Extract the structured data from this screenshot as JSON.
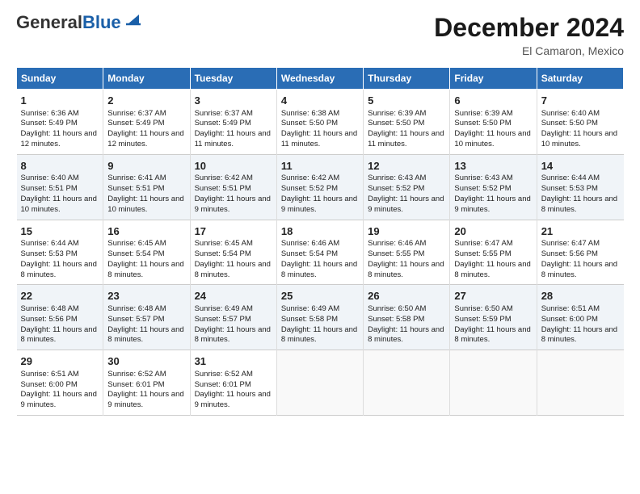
{
  "header": {
    "logo_general": "General",
    "logo_blue": "Blue",
    "month_title": "December 2024",
    "location": "El Camaron, Mexico"
  },
  "days_of_week": [
    "Sunday",
    "Monday",
    "Tuesday",
    "Wednesday",
    "Thursday",
    "Friday",
    "Saturday"
  ],
  "weeks": [
    [
      {
        "day": 1,
        "sunrise": "Sunrise: 6:36 AM",
        "sunset": "Sunset: 5:49 PM",
        "daylight": "Daylight: 11 hours and 12 minutes."
      },
      {
        "day": 2,
        "sunrise": "Sunrise: 6:37 AM",
        "sunset": "Sunset: 5:49 PM",
        "daylight": "Daylight: 11 hours and 12 minutes."
      },
      {
        "day": 3,
        "sunrise": "Sunrise: 6:37 AM",
        "sunset": "Sunset: 5:49 PM",
        "daylight": "Daylight: 11 hours and 11 minutes."
      },
      {
        "day": 4,
        "sunrise": "Sunrise: 6:38 AM",
        "sunset": "Sunset: 5:50 PM",
        "daylight": "Daylight: 11 hours and 11 minutes."
      },
      {
        "day": 5,
        "sunrise": "Sunrise: 6:39 AM",
        "sunset": "Sunset: 5:50 PM",
        "daylight": "Daylight: 11 hours and 11 minutes."
      },
      {
        "day": 6,
        "sunrise": "Sunrise: 6:39 AM",
        "sunset": "Sunset: 5:50 PM",
        "daylight": "Daylight: 11 hours and 10 minutes."
      },
      {
        "day": 7,
        "sunrise": "Sunrise: 6:40 AM",
        "sunset": "Sunset: 5:50 PM",
        "daylight": "Daylight: 11 hours and 10 minutes."
      }
    ],
    [
      {
        "day": 8,
        "sunrise": "Sunrise: 6:40 AM",
        "sunset": "Sunset: 5:51 PM",
        "daylight": "Daylight: 11 hours and 10 minutes."
      },
      {
        "day": 9,
        "sunrise": "Sunrise: 6:41 AM",
        "sunset": "Sunset: 5:51 PM",
        "daylight": "Daylight: 11 hours and 10 minutes."
      },
      {
        "day": 10,
        "sunrise": "Sunrise: 6:42 AM",
        "sunset": "Sunset: 5:51 PM",
        "daylight": "Daylight: 11 hours and 9 minutes."
      },
      {
        "day": 11,
        "sunrise": "Sunrise: 6:42 AM",
        "sunset": "Sunset: 5:52 PM",
        "daylight": "Daylight: 11 hours and 9 minutes."
      },
      {
        "day": 12,
        "sunrise": "Sunrise: 6:43 AM",
        "sunset": "Sunset: 5:52 PM",
        "daylight": "Daylight: 11 hours and 9 minutes."
      },
      {
        "day": 13,
        "sunrise": "Sunrise: 6:43 AM",
        "sunset": "Sunset: 5:52 PM",
        "daylight": "Daylight: 11 hours and 9 minutes."
      },
      {
        "day": 14,
        "sunrise": "Sunrise: 6:44 AM",
        "sunset": "Sunset: 5:53 PM",
        "daylight": "Daylight: 11 hours and 8 minutes."
      }
    ],
    [
      {
        "day": 15,
        "sunrise": "Sunrise: 6:44 AM",
        "sunset": "Sunset: 5:53 PM",
        "daylight": "Daylight: 11 hours and 8 minutes."
      },
      {
        "day": 16,
        "sunrise": "Sunrise: 6:45 AM",
        "sunset": "Sunset: 5:54 PM",
        "daylight": "Daylight: 11 hours and 8 minutes."
      },
      {
        "day": 17,
        "sunrise": "Sunrise: 6:45 AM",
        "sunset": "Sunset: 5:54 PM",
        "daylight": "Daylight: 11 hours and 8 minutes."
      },
      {
        "day": 18,
        "sunrise": "Sunrise: 6:46 AM",
        "sunset": "Sunset: 5:54 PM",
        "daylight": "Daylight: 11 hours and 8 minutes."
      },
      {
        "day": 19,
        "sunrise": "Sunrise: 6:46 AM",
        "sunset": "Sunset: 5:55 PM",
        "daylight": "Daylight: 11 hours and 8 minutes."
      },
      {
        "day": 20,
        "sunrise": "Sunrise: 6:47 AM",
        "sunset": "Sunset: 5:55 PM",
        "daylight": "Daylight: 11 hours and 8 minutes."
      },
      {
        "day": 21,
        "sunrise": "Sunrise: 6:47 AM",
        "sunset": "Sunset: 5:56 PM",
        "daylight": "Daylight: 11 hours and 8 minutes."
      }
    ],
    [
      {
        "day": 22,
        "sunrise": "Sunrise: 6:48 AM",
        "sunset": "Sunset: 5:56 PM",
        "daylight": "Daylight: 11 hours and 8 minutes."
      },
      {
        "day": 23,
        "sunrise": "Sunrise: 6:48 AM",
        "sunset": "Sunset: 5:57 PM",
        "daylight": "Daylight: 11 hours and 8 minutes."
      },
      {
        "day": 24,
        "sunrise": "Sunrise: 6:49 AM",
        "sunset": "Sunset: 5:57 PM",
        "daylight": "Daylight: 11 hours and 8 minutes."
      },
      {
        "day": 25,
        "sunrise": "Sunrise: 6:49 AM",
        "sunset": "Sunset: 5:58 PM",
        "daylight": "Daylight: 11 hours and 8 minutes."
      },
      {
        "day": 26,
        "sunrise": "Sunrise: 6:50 AM",
        "sunset": "Sunset: 5:58 PM",
        "daylight": "Daylight: 11 hours and 8 minutes."
      },
      {
        "day": 27,
        "sunrise": "Sunrise: 6:50 AM",
        "sunset": "Sunset: 5:59 PM",
        "daylight": "Daylight: 11 hours and 8 minutes."
      },
      {
        "day": 28,
        "sunrise": "Sunrise: 6:51 AM",
        "sunset": "Sunset: 6:00 PM",
        "daylight": "Daylight: 11 hours and 8 minutes."
      }
    ],
    [
      {
        "day": 29,
        "sunrise": "Sunrise: 6:51 AM",
        "sunset": "Sunset: 6:00 PM",
        "daylight": "Daylight: 11 hours and 9 minutes."
      },
      {
        "day": 30,
        "sunrise": "Sunrise: 6:52 AM",
        "sunset": "Sunset: 6:01 PM",
        "daylight": "Daylight: 11 hours and 9 minutes."
      },
      {
        "day": 31,
        "sunrise": "Sunrise: 6:52 AM",
        "sunset": "Sunset: 6:01 PM",
        "daylight": "Daylight: 11 hours and 9 minutes."
      },
      null,
      null,
      null,
      null
    ]
  ]
}
